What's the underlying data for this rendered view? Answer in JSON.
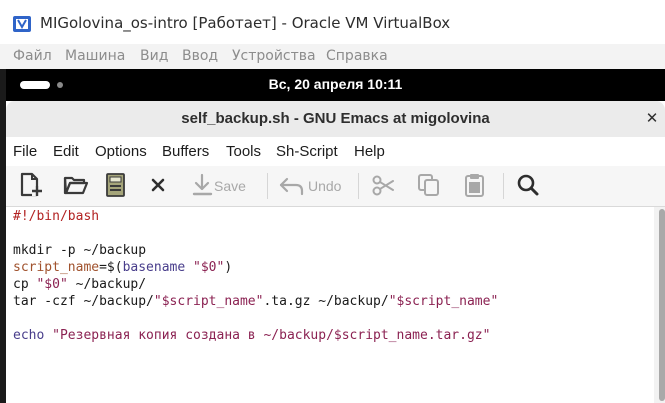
{
  "vbox": {
    "title": "MIGolovina_os-intro [Работает] - Oracle VM VirtualBox",
    "menu": [
      "Файл",
      "Машина",
      "Вид",
      "Ввод",
      "Устройства",
      "Справка"
    ]
  },
  "gnome": {
    "clock": "Вс, 20 апреля  10:11"
  },
  "emacs": {
    "title": "self_backup.sh - GNU Emacs at migolovina",
    "close_icon": "close-icon",
    "menu": [
      "File",
      "Edit",
      "Options",
      "Buffers",
      "Tools",
      "Sh-Script",
      "Help"
    ],
    "toolbar": {
      "new_file_icon": "new-file-icon",
      "open_icon": "open-folder-icon",
      "save_file_icon": "save-file-icon",
      "close_buffer_icon": "close-buffer-icon",
      "save_label": "Save",
      "undo_label": "Undo",
      "cut_icon": "cut-icon",
      "copy_icon": "copy-icon",
      "paste_icon": "paste-icon",
      "search_icon": "search-icon"
    },
    "buffer": {
      "lines": [
        [
          {
            "t": "#!/bin/bash",
            "c": "comment"
          }
        ],
        [],
        [
          {
            "t": "mkdir -p ~/backup",
            "c": "plain"
          }
        ],
        [
          {
            "t": "script_name",
            "c": "var"
          },
          {
            "t": "=$(",
            "c": "plain"
          },
          {
            "t": "basename",
            "c": "builtin"
          },
          {
            "t": " ",
            "c": "plain"
          },
          {
            "t": "\"$0\"",
            "c": "string"
          },
          {
            "t": ")",
            "c": "plain"
          }
        ],
        [
          {
            "t": "cp ",
            "c": "plain"
          },
          {
            "t": "\"$0\"",
            "c": "string"
          },
          {
            "t": " ~/backup/",
            "c": "plain"
          }
        ],
        [
          {
            "t": "tar -czf ~/backup/",
            "c": "plain"
          },
          {
            "t": "\"$script_name\"",
            "c": "string"
          },
          {
            "t": ".ta.gz ~/backup/",
            "c": "plain"
          },
          {
            "t": "\"$script_name\"",
            "c": "string"
          }
        ],
        [],
        [
          {
            "t": "echo",
            "c": "builtin"
          },
          {
            "t": " ",
            "c": "plain"
          },
          {
            "t": "\"Резервная копия создана в ~/backup/$script_name.tar.gz\"",
            "c": "string"
          }
        ]
      ]
    }
  },
  "colors": {
    "comment": "#b22222",
    "string": "#8b2252",
    "variable": "#a0522d",
    "builtin": "#483d8b"
  }
}
